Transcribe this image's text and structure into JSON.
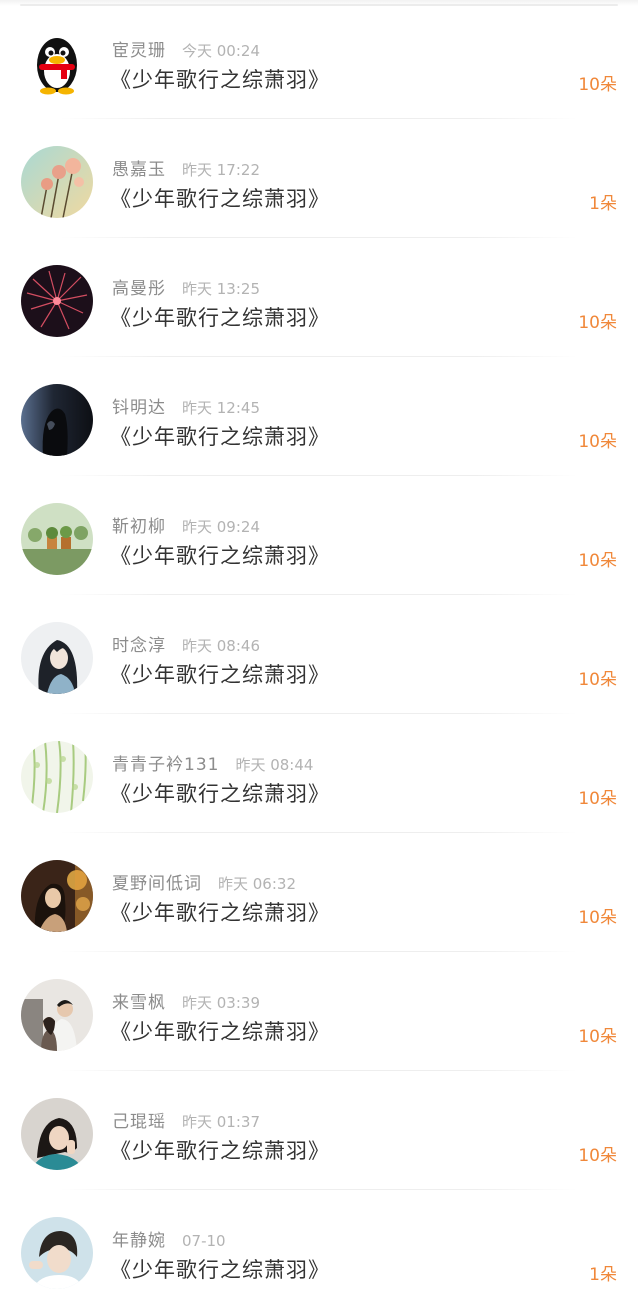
{
  "gifts": [
    {
      "avatar": "qq-penguin-avatar",
      "name": "宦灵珊",
      "time": "今天 00:24",
      "book": "《少年歌行之综萧羽》",
      "count": "10朵"
    },
    {
      "avatar": "flowers-avatar",
      "name": "愚嘉玉",
      "time": "昨天 17:22",
      "book": "《少年歌行之综萧羽》",
      "count": "1朵"
    },
    {
      "avatar": "fireworks-avatar",
      "name": "高曼彤",
      "time": "昨天 13:25",
      "book": "《少年歌行之综萧羽》",
      "count": "10朵"
    },
    {
      "avatar": "silhouette-avatar",
      "name": "钭明达",
      "time": "昨天 12:45",
      "book": "《少年歌行之综萧羽》",
      "count": "10朵"
    },
    {
      "avatar": "plants-avatar",
      "name": "靳初柳",
      "time": "昨天 09:24",
      "book": "《少年歌行之综萧羽》",
      "count": "10朵"
    },
    {
      "avatar": "anime-character-avatar",
      "name": "时念淳",
      "time": "昨天 08:46",
      "book": "《少年歌行之综萧羽》",
      "count": "10朵"
    },
    {
      "avatar": "willow-avatar",
      "name": "青青子衿131",
      "time": "昨天 08:44",
      "book": "《少年歌行之综萧羽》",
      "count": "10朵"
    },
    {
      "avatar": "girl-lights-avatar",
      "name": "夏野间低词",
      "time": "昨天 06:32",
      "book": "《少年歌行之综萧羽》",
      "count": "10朵"
    },
    {
      "avatar": "couple-avatar",
      "name": "来雪枫",
      "time": "昨天 03:39",
      "book": "《少年歌行之综萧羽》",
      "count": "10朵"
    },
    {
      "avatar": "girl-teal-avatar",
      "name": "己琨瑶",
      "time": "昨天 01:37",
      "book": "《少年歌行之综萧羽》",
      "count": "10朵"
    },
    {
      "avatar": "boy-avatar",
      "name": "年静婉",
      "time": "07-10",
      "book": "《少年歌行之综萧羽》",
      "count": "1朵"
    }
  ]
}
